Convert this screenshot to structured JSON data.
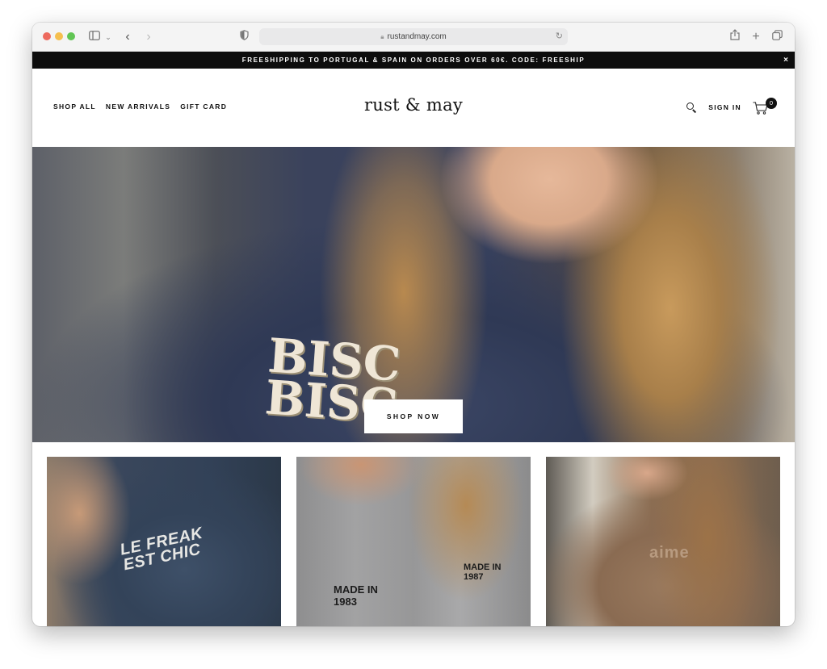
{
  "browser": {
    "url": "rustandmay.com",
    "icons": {
      "sidebar": "sidebar-icon",
      "back": "chevron-left-icon",
      "forward": "chevron-right-icon",
      "privacy": "shield-icon",
      "lock": "lock-icon",
      "reload": "reload-icon",
      "share": "share-icon",
      "new_tab": "plus-icon",
      "tabs": "tabs-overview-icon"
    }
  },
  "announcement": {
    "text": "FREESHIPPING TO PORTUGAL & SPAIN ON ORDERS OVER 60€. CODE: FREESHIP",
    "close": "×"
  },
  "header": {
    "logo": "rust & may",
    "nav": [
      "SHOP ALL",
      "NEW ARRIVALS",
      "GIFT CARD"
    ],
    "sign_in": "SIGN IN",
    "cart_count": "0"
  },
  "hero": {
    "cta": "SHOP NOW",
    "print_text": "BISC\nBISC"
  },
  "tiles": [
    {
      "print_text": "LE FREAK\nEST CHIC"
    },
    {
      "print_text_1": "MADE IN\n1983",
      "print_text_2": "MADE IN\n1987"
    },
    {
      "print_text": "aime"
    }
  ],
  "colors": {
    "announcement_bg": "#0d0d0d",
    "announcement_fg": "#ffffff",
    "text": "#111111",
    "page_bg": "#ffffff"
  }
}
